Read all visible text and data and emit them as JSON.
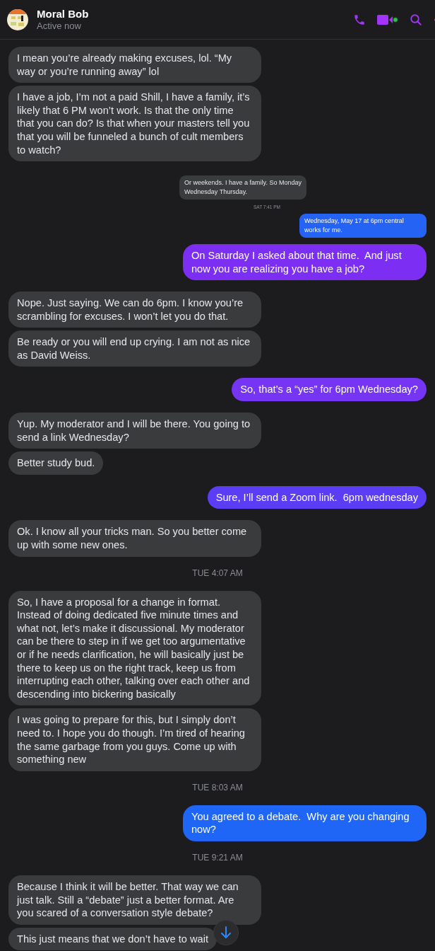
{
  "header": {
    "name": "Moral Bob",
    "status": "Active now",
    "video_active": true
  },
  "messages": [
    {
      "kind": "incoming",
      "text": "I mean you’re already making excuses, lol. “My way or you’re running away” lol"
    },
    {
      "kind": "incoming",
      "text": "I have a job, I’m not a paid Shill, I have a family, it’s likely that 6 PM won’t work. Is that the only time that you can do? Is that when your masters tell you that you will be funneled a bunch of cult members to watch?"
    },
    {
      "kind": "incoming_small",
      "text": "Or weekends. I have a family. So Monday Wednesday Thursday."
    },
    {
      "kind": "time_small",
      "text": "SAT 7:41 PM"
    },
    {
      "kind": "outgoing_small",
      "text": "Wednesday, May 17 at 6pm central works for me.",
      "color": "#2563f5"
    },
    {
      "kind": "outgoing",
      "text": "On Saturday I asked about that time.  And just now you are realizing you have a job?",
      "color": "#7c2ff2"
    },
    {
      "kind": "incoming",
      "text": "Nope. Just saying. We can do 6pm. I know you’re scrambling for excuses. I won’t let you do that."
    },
    {
      "kind": "incoming",
      "text": "Be ready or you will end up crying. I am not as nice as David Weiss."
    },
    {
      "kind": "outgoing",
      "text": "So, that’s a “yes” for 6pm Wednesday?",
      "color": "#7535f3"
    },
    {
      "kind": "incoming",
      "text": "Yup. My moderator and I will be there. You going to send a link Wednesday?"
    },
    {
      "kind": "incoming",
      "text": "Better study bud."
    },
    {
      "kind": "outgoing",
      "text": "Sure, I’ll send a Zoom link.  6pm wednesday",
      "color": "#5b3df5"
    },
    {
      "kind": "incoming",
      "text": "Ok. I know all your tricks man. So you better come up with some new ones."
    },
    {
      "kind": "time",
      "text": "TUE 4:07 AM"
    },
    {
      "kind": "incoming",
      "text": "So, I have a proposal for a change in format. Instead of doing dedicated five minute times and what not, let’s make it discussional. My moderator can be there to step in if we get too argumentative or if he needs clarification, he will basically just be there to keep us on the right track, keep us from interrupting each other, talking over each other and descending into bickering basically"
    },
    {
      "kind": "incoming",
      "text": "I was going to prepare for this, but I simply don’t need to. I hope you do though. I’m tired of hearing the same garbage from you guys. Come up with something new"
    },
    {
      "kind": "time",
      "text": "TUE 8:03 AM"
    },
    {
      "kind": "outgoing",
      "text": "You agreed to a debate.  Why are you changing now?",
      "color": "#1f66f6"
    },
    {
      "kind": "time",
      "text": "TUE 9:21 AM"
    },
    {
      "kind": "incoming",
      "text": "Because I think it will be better. That way we can just talk. Still a “debate” just a better format. Are you scared of a conversation style debate?"
    },
    {
      "kind": "incoming",
      "text": "This just means that we don’t have to wait"
    }
  ]
}
